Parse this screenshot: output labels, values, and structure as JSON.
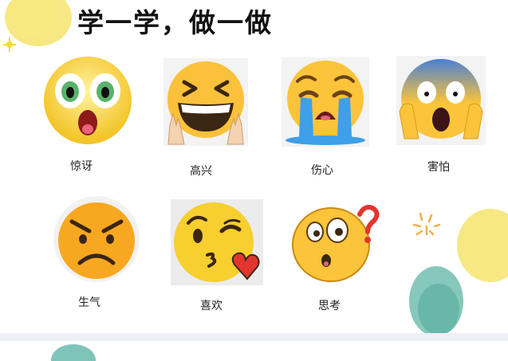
{
  "slide": {
    "title": "学一学，做一做",
    "emotions": [
      {
        "label": "惊讶",
        "icon": "surprised-face-icon"
      },
      {
        "label": "高兴",
        "icon": "laughing-face-icon"
      },
      {
        "label": "伤心",
        "icon": "crying-face-icon"
      },
      {
        "label": "害怕",
        "icon": "scared-face-icon"
      },
      {
        "label": "生气",
        "icon": "angry-face-icon"
      },
      {
        "label": "喜欢",
        "icon": "kissing-face-icon"
      },
      {
        "label": "思考",
        "icon": "thinking-face-icon"
      }
    ]
  },
  "colors": {
    "emoji_yellow": "#f8c530",
    "tear_blue": "#3ea0e8",
    "heart_red": "#e2352f",
    "watercolor_yellow": "#f5e36b",
    "watercolor_teal": "#5fb5a6"
  }
}
